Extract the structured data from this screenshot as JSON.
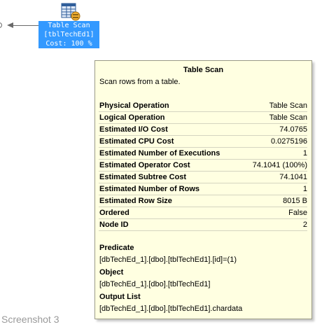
{
  "node": {
    "icon": "table-scan-icon",
    "label_line1": "Table Scan",
    "label_line2": "[tblTechEd1]",
    "label_line3": "Cost: 100 %",
    "color": "#3399ff"
  },
  "tooltip": {
    "title": "Table Scan",
    "description": "Scan rows from a table.",
    "background": "#ffffe1",
    "properties": [
      {
        "key": "Physical Operation",
        "value": "Table Scan"
      },
      {
        "key": "Logical Operation",
        "value": "Table Scan"
      },
      {
        "key": "Estimated I/O Cost",
        "value": "74.0765"
      },
      {
        "key": "Estimated CPU Cost",
        "value": "0.0275196"
      },
      {
        "key": "Estimated Number of Executions",
        "value": "1"
      },
      {
        "key": "Estimated Operator Cost",
        "value": "74.1041 (100%)"
      },
      {
        "key": "Estimated Subtree Cost",
        "value": "74.1041"
      },
      {
        "key": "Estimated Number of Rows",
        "value": "1"
      },
      {
        "key": "Estimated Row Size",
        "value": "8015 B"
      },
      {
        "key": "Ordered",
        "value": "False"
      },
      {
        "key": "Node ID",
        "value": "2"
      }
    ],
    "predicate_label": "Predicate",
    "predicate_value": "[dbTechEd_1].[dbo].[tblTechEd1].[id]=(1)",
    "object_label": "Object",
    "object_value": "[dbTechEd_1].[dbo].[tblTechEd1]",
    "output_label": "Output List",
    "output_value": "[dbTechEd_1].[dbo].[tblTechEd1].chardata"
  },
  "caption": "Screenshot 3"
}
